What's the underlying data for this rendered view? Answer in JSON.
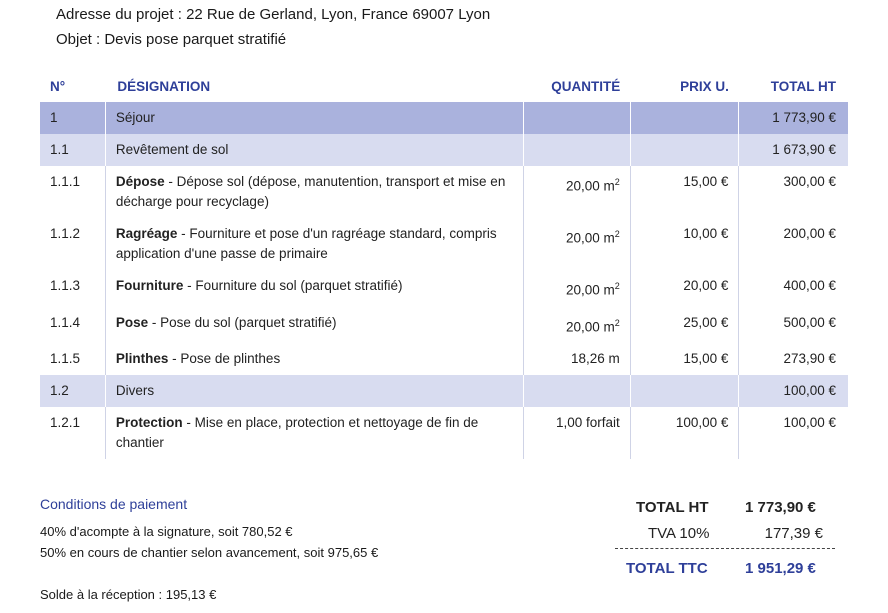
{
  "header": {
    "address": "Adresse du projet : 22 Rue de Gerland, Lyon, France 69007 Lyon",
    "object": "Objet : Devis pose parquet stratifié"
  },
  "table": {
    "columns": [
      "N°",
      "DÉSIGNATION",
      "QUANTITÉ",
      "PRIX U.",
      "TOTAL HT"
    ],
    "rows": [
      {
        "num": "1",
        "title": "",
        "desc": "Séjour",
        "qty": "",
        "qty_unit": "",
        "price": "",
        "total": "1 773,90 €",
        "level": 1
      },
      {
        "num": "1.1",
        "title": "",
        "desc": "Revêtement de sol",
        "qty": "",
        "qty_unit": "",
        "price": "",
        "total": "1 673,90 €",
        "level": 2
      },
      {
        "num": "1.1.1",
        "title": "Dépose",
        "desc": " - Dépose sol (dépose, manutention, transport et mise en décharge pour recyclage)",
        "qty": "20,00 m",
        "qty_unit": "2",
        "price": "15,00 €",
        "total": "300,00 €",
        "level": 3
      },
      {
        "num": "1.1.2",
        "title": "Ragréage",
        "desc": " - Fourniture et pose d'un ragréage standard, compris application d'une passe de primaire",
        "qty": "20,00 m",
        "qty_unit": "2",
        "price": "10,00 €",
        "total": "200,00 €",
        "level": 3
      },
      {
        "num": "1.1.3",
        "title": "Fourniture",
        "desc": " - Fourniture du sol (parquet stratifié)",
        "qty": "20,00 m",
        "qty_unit": "2",
        "price": "20,00 €",
        "total": "400,00 €",
        "level": 3
      },
      {
        "num": "1.1.4",
        "title": "Pose",
        "desc": " - Pose du sol (parquet stratifié)",
        "qty": "20,00 m",
        "qty_unit": "2",
        "price": "25,00 €",
        "total": "500,00 €",
        "level": 3
      },
      {
        "num": "1.1.5",
        "title": "Plinthes",
        "desc": " - Pose de plinthes",
        "qty": "18,26 m",
        "qty_unit": "",
        "price": "15,00 €",
        "total": "273,90 €",
        "level": 3
      },
      {
        "num": "1.2",
        "title": "",
        "desc": "Divers",
        "qty": "",
        "qty_unit": "",
        "price": "",
        "total": "100,00 €",
        "level": 2
      },
      {
        "num": "1.2.1",
        "title": "Protection",
        "desc": " - Mise en place, protection et nettoyage de fin de chantier",
        "qty": "1,00 forfait",
        "qty_unit": "",
        "price": "100,00 €",
        "total": "100,00 €",
        "level": 3
      }
    ]
  },
  "conditions": {
    "title": "Conditions de paiement",
    "line1": "40% d'acompte à la signature, soit 780,52 €",
    "line2": "50% en cours de chantier selon avancement, soit 975,65 €",
    "line3": "Solde à la réception : 195,13 €"
  },
  "totals": {
    "ht_label": "TOTAL HT",
    "ht_value": "1 773,90 €",
    "tva_label": "TVA 10%",
    "tva_value": "177,39 €",
    "ttc_label": "TOTAL TTC",
    "ttc_value": "1 951,29 €"
  },
  "colors": {
    "accent": "#2e3f99",
    "level1": "#aab2dd",
    "level2": "#d8dcf0"
  }
}
